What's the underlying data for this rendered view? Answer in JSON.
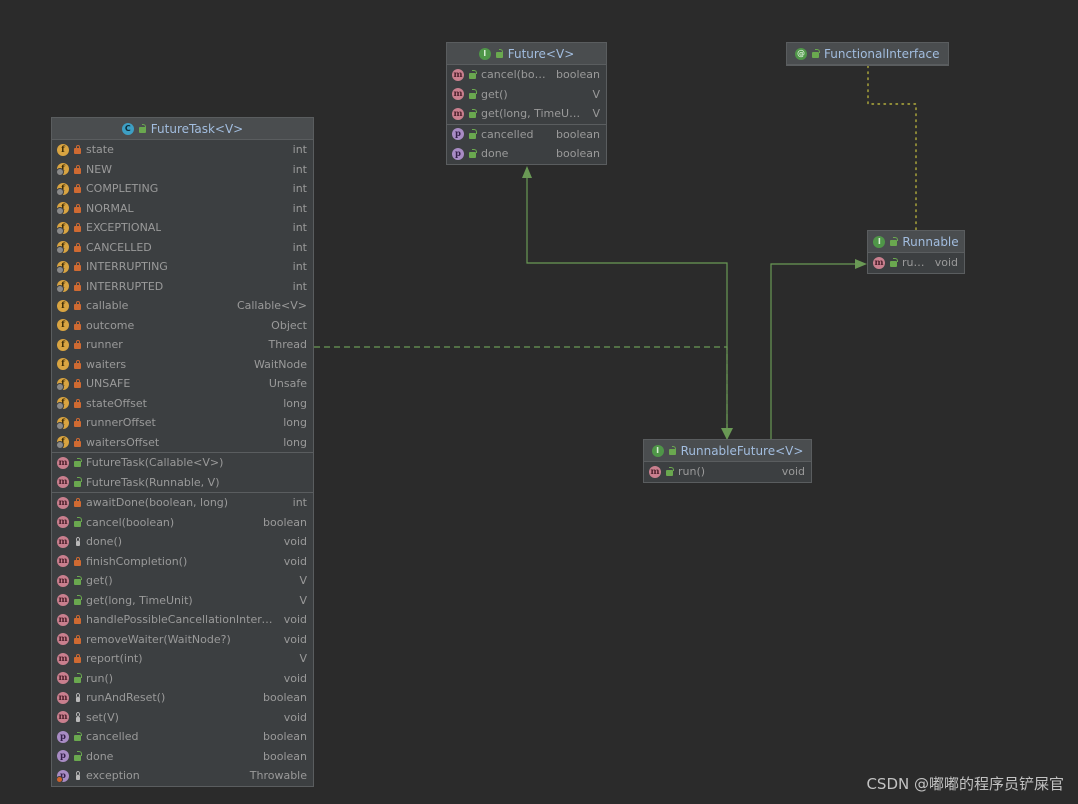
{
  "watermark": "CSDN @嘟嘟的程序员铲屎官",
  "colors": {
    "background": "#2b2b2b",
    "box_fill": "#3c3f41",
    "box_header": "#4a4d4f",
    "box_border": "#5a5d5f",
    "title_text": "#9ab4d0",
    "member_text": "#9a9a9a",
    "edge_green": "#6a9955",
    "edge_yellow": "#b3ae3c",
    "icon_field": "#d9a441",
    "icon_method": "#c97f8e",
    "icon_property": "#a88bc4",
    "icon_interface": "#4f9648",
    "icon_class": "#3d9fc4",
    "lock_private": "#cf6a32",
    "lock_public": "#6aa84f"
  },
  "boxes": {
    "future_task": {
      "title": "FutureTask<V>",
      "kind_icon": "class-icon",
      "kind_glyph": "C",
      "visibility": "public",
      "sections": [
        {
          "name": "fields",
          "rows": [
            {
              "icon": "field-icon",
              "glyph": "f",
              "static": false,
              "vis": "private",
              "name": "state",
              "type": "int"
            },
            {
              "icon": "field-icon",
              "glyph": "f",
              "static": true,
              "vis": "private",
              "name": "NEW",
              "type": "int"
            },
            {
              "icon": "field-icon",
              "glyph": "f",
              "static": true,
              "vis": "private",
              "name": "COMPLETING",
              "type": "int"
            },
            {
              "icon": "field-icon",
              "glyph": "f",
              "static": true,
              "vis": "private",
              "name": "NORMAL",
              "type": "int"
            },
            {
              "icon": "field-icon",
              "glyph": "f",
              "static": true,
              "vis": "private",
              "name": "EXCEPTIONAL",
              "type": "int"
            },
            {
              "icon": "field-icon",
              "glyph": "f",
              "static": true,
              "vis": "private",
              "name": "CANCELLED",
              "type": "int"
            },
            {
              "icon": "field-icon",
              "glyph": "f",
              "static": true,
              "vis": "private",
              "name": "INTERRUPTING",
              "type": "int"
            },
            {
              "icon": "field-icon",
              "glyph": "f",
              "static": true,
              "vis": "private",
              "name": "INTERRUPTED",
              "type": "int"
            },
            {
              "icon": "field-icon",
              "glyph": "f",
              "static": false,
              "vis": "private",
              "name": "callable",
              "type": "Callable<V>"
            },
            {
              "icon": "field-icon",
              "glyph": "f",
              "static": false,
              "vis": "private",
              "name": "outcome",
              "type": "Object"
            },
            {
              "icon": "field-icon",
              "glyph": "f",
              "static": false,
              "vis": "private",
              "name": "runner",
              "type": "Thread"
            },
            {
              "icon": "field-icon",
              "glyph": "f",
              "static": false,
              "vis": "private",
              "name": "waiters",
              "type": "WaitNode"
            },
            {
              "icon": "field-icon",
              "glyph": "f",
              "static": true,
              "vis": "private",
              "name": "UNSAFE",
              "type": "Unsafe"
            },
            {
              "icon": "field-icon",
              "glyph": "f",
              "static": true,
              "vis": "private",
              "name": "stateOffset",
              "type": "long"
            },
            {
              "icon": "field-icon",
              "glyph": "f",
              "static": true,
              "vis": "private",
              "name": "runnerOffset",
              "type": "long"
            },
            {
              "icon": "field-icon",
              "glyph": "f",
              "static": true,
              "vis": "private",
              "name": "waitersOffset",
              "type": "long"
            }
          ]
        },
        {
          "name": "constructors",
          "rows": [
            {
              "icon": "method-icon",
              "glyph": "m",
              "static": false,
              "vis": "public",
              "name": "FutureTask(Callable<V>)",
              "type": ""
            },
            {
              "icon": "method-icon",
              "glyph": "m",
              "static": false,
              "vis": "public",
              "name": "FutureTask(Runnable, V)",
              "type": ""
            }
          ]
        },
        {
          "name": "methods",
          "rows": [
            {
              "icon": "method-icon",
              "glyph": "m",
              "static": false,
              "vis": "private",
              "name": "awaitDone(boolean, long)",
              "type": "int"
            },
            {
              "icon": "method-icon",
              "glyph": "m",
              "static": false,
              "vis": "public",
              "name": "cancel(boolean)",
              "type": "boolean"
            },
            {
              "icon": "method-icon",
              "glyph": "m",
              "static": false,
              "vis": "protected",
              "name": "done()",
              "type": "void"
            },
            {
              "icon": "method-icon",
              "glyph": "m",
              "static": false,
              "vis": "private",
              "name": "finishCompletion()",
              "type": "void"
            },
            {
              "icon": "method-icon",
              "glyph": "m",
              "static": false,
              "vis": "public",
              "name": "get()",
              "type": "V"
            },
            {
              "icon": "method-icon",
              "glyph": "m",
              "static": false,
              "vis": "public",
              "name": "get(long, TimeUnit)",
              "type": "V"
            },
            {
              "icon": "method-icon",
              "glyph": "m",
              "static": false,
              "vis": "private",
              "name": "handlePossibleCancellationInterrupt(int)",
              "type": "void"
            },
            {
              "icon": "method-icon",
              "glyph": "m",
              "static": false,
              "vis": "private",
              "name": "removeWaiter(WaitNode?)",
              "type": "void"
            },
            {
              "icon": "method-icon",
              "glyph": "m",
              "static": false,
              "vis": "private",
              "name": "report(int)",
              "type": "V"
            },
            {
              "icon": "method-icon",
              "glyph": "m",
              "static": false,
              "vis": "public",
              "name": "run()",
              "type": "void"
            },
            {
              "icon": "method-icon",
              "glyph": "m",
              "static": false,
              "vis": "protected",
              "name": "runAndReset()",
              "type": "boolean"
            },
            {
              "icon": "method-icon",
              "glyph": "m",
              "static": false,
              "vis": "protected",
              "name": "set(V)",
              "type": "void"
            },
            {
              "icon": "property-icon",
              "glyph": "p",
              "static": false,
              "vis": "public",
              "name": "cancelled",
              "type": "boolean"
            },
            {
              "icon": "property-icon",
              "glyph": "p",
              "static": false,
              "vis": "public",
              "name": "done",
              "type": "boolean"
            },
            {
              "icon": "property-icon",
              "glyph": "p",
              "static": false,
              "vis": "protected",
              "name": "exception",
              "type": "Throwable",
              "error": true
            }
          ]
        }
      ]
    },
    "future": {
      "title": "Future<V>",
      "kind_icon": "interface-icon",
      "kind_glyph": "I",
      "visibility": "public",
      "sections": [
        {
          "name": "methods",
          "rows": [
            {
              "icon": "method-icon",
              "glyph": "m",
              "static": false,
              "vis": "public",
              "name": "cancel(boolean)",
              "type": "boolean"
            },
            {
              "icon": "method-icon",
              "glyph": "m",
              "static": false,
              "vis": "public",
              "name": "get()",
              "type": "V"
            },
            {
              "icon": "method-icon",
              "glyph": "m",
              "static": false,
              "vis": "public",
              "name": "get(long, TimeUnit)",
              "type": "V"
            }
          ]
        },
        {
          "name": "properties",
          "rows": [
            {
              "icon": "property-icon",
              "glyph": "p",
              "static": false,
              "vis": "public",
              "name": "cancelled",
              "type": "boolean"
            },
            {
              "icon": "property-icon",
              "glyph": "p",
              "static": false,
              "vis": "public",
              "name": "done",
              "type": "boolean"
            }
          ]
        }
      ]
    },
    "functional_interface": {
      "title": "FunctionalInterface",
      "kind_icon": "annotation-icon",
      "kind_glyph": "@",
      "visibility": "public",
      "sections": []
    },
    "runnable": {
      "title": "Runnable",
      "kind_icon": "interface-icon",
      "kind_glyph": "I",
      "visibility": "public",
      "sections": [
        {
          "name": "methods",
          "rows": [
            {
              "icon": "method-icon",
              "glyph": "m",
              "static": false,
              "vis": "public",
              "name": "run()",
              "type": "void"
            }
          ]
        }
      ]
    },
    "runnable_future": {
      "title": "RunnableFuture<V>",
      "kind_icon": "interface-icon",
      "kind_glyph": "I",
      "visibility": "public",
      "sections": [
        {
          "name": "methods",
          "rows": [
            {
              "icon": "method-icon",
              "glyph": "m",
              "static": false,
              "vis": "public",
              "name": "run()",
              "type": "void"
            }
          ]
        }
      ]
    }
  },
  "edges": [
    {
      "name": "runnablefuture-extends-future",
      "style": "solid",
      "color": "#6a9955",
      "arrow": "triangle"
    },
    {
      "name": "runnablefuture-extends-runnable",
      "style": "solid",
      "color": "#6a9955",
      "arrow": "triangle"
    },
    {
      "name": "futuretask-implements-runnablefuture",
      "style": "dashed",
      "color": "#6a9955",
      "arrow": "triangle"
    },
    {
      "name": "runnable-annotated-functionalinterface",
      "style": "dotted",
      "color": "#b3ae3c",
      "arrow": "none"
    }
  ]
}
